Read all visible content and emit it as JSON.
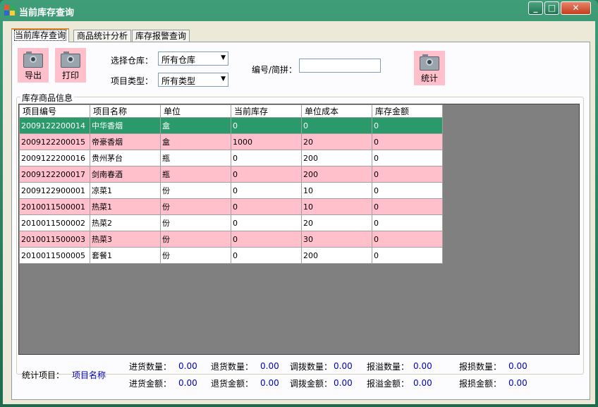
{
  "window": {
    "title": "当前库存查询",
    "min_label": "_",
    "max_label": "□",
    "close_label": "✕"
  },
  "tabs": [
    {
      "label": "当前库存查询"
    },
    {
      "label": "商品统计分析"
    },
    {
      "label": "库存报警查询"
    }
  ],
  "toolbar": {
    "export_label": "导出",
    "print_label": "打印",
    "stats_label": "统计"
  },
  "filters": {
    "warehouse_label": "选择仓库：",
    "warehouse_value": "所有仓库",
    "type_label": "项目类型：",
    "type_value": "所有类型",
    "code_label": "编号/简拼：",
    "code_value": ""
  },
  "group_title": "库存商品信息",
  "table": {
    "headers": [
      "项目编号",
      "项目名称",
      "单位",
      "当前库存",
      "单位成本",
      "库存金额"
    ],
    "rows": [
      [
        "2009122200014",
        "中华香烟",
        "盒",
        "0",
        "0",
        "0"
      ],
      [
        "2009122200015",
        "帝豪香烟",
        "盒",
        "1000",
        "20",
        "0"
      ],
      [
        "2009122200016",
        "贵州茅台",
        "瓶",
        "0",
        "200",
        "0"
      ],
      [
        "2009122200017",
        "剑南春酒",
        "瓶",
        "0",
        "200",
        "0"
      ],
      [
        "2009122900001",
        "凉菜1",
        "份",
        "0",
        "10",
        "0"
      ],
      [
        "2010011500001",
        "热菜1",
        "份",
        "0",
        "10",
        "0"
      ],
      [
        "2010011500002",
        "热菜2",
        "份",
        "0",
        "20",
        "0"
      ],
      [
        "2010011500003",
        "热菜3",
        "份",
        "0",
        "30",
        "0"
      ],
      [
        "2010011500005",
        "套餐1",
        "份",
        "0",
        "200",
        "0"
      ]
    ]
  },
  "summary": {
    "stat_item_label": "统计项目：",
    "stat_item_value": "项目名称",
    "purchase_qty_label": "进货数量：",
    "purchase_qty": "0.00",
    "return_qty_label": "退货数量：",
    "return_qty": "0.00",
    "transfer_qty_label": "调拨数量：",
    "transfer_qty": "0.00",
    "overflow_qty_label": "报溢数量：",
    "overflow_qty": "0.00",
    "loss_qty_label": "报损数量：",
    "loss_qty": "0.00",
    "purchase_amt_label": "进货金额：",
    "purchase_amt": "0.00",
    "return_amt_label": "退货金额：",
    "return_amt": "0.00",
    "transfer_amt_label": "调拨金额：",
    "transfer_amt": "0.00",
    "overflow_amt_label": "报溢金额：",
    "overflow_amt": "0.00",
    "loss_amt_label": "报损金额：",
    "loss_amt": "0.00"
  },
  "colors": {
    "title_bar": "#2c7a5c",
    "selected_row": "#2a9a6a",
    "alt_row": "#ffc0cb",
    "value_text": "#0000c0"
  }
}
